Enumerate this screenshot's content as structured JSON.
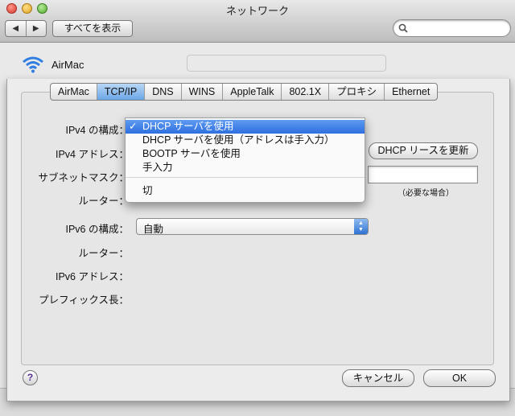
{
  "window": {
    "title": "ネットワーク"
  },
  "toolbar": {
    "back": "◀",
    "forward": "▶",
    "show_all": "すべてを表示",
    "search_placeholder": ""
  },
  "interface": {
    "name": "AirMac"
  },
  "tabs": [
    {
      "label": "AirMac"
    },
    {
      "label": "TCP/IP",
      "selected": true
    },
    {
      "label": "DNS"
    },
    {
      "label": "WINS"
    },
    {
      "label": "AppleTalk"
    },
    {
      "label": "802.1X"
    },
    {
      "label": "プロキシ"
    },
    {
      "label": "Ethernet"
    }
  ],
  "form": {
    "ipv4_config_label": "IPv4 の構成：",
    "ipv4_address_label": "IPv4 アドレス：",
    "subnet_mask_label": "サブネットマスク：",
    "router_label": "ルーター：",
    "ipv6_config_label": "IPv6 の構成：",
    "ipv6_config_value": "自動",
    "ipv6_router_label": "ルーター：",
    "ipv6_address_label": "IPv6 アドレス：",
    "prefix_length_label": "プレフィックス長：",
    "renew_button": "DHCP リースを更新",
    "required_note": "（必要な場合）"
  },
  "ipv4_menu": {
    "checkmark": "✓",
    "items": [
      {
        "label": "DHCP サーバを使用",
        "selected": true
      },
      {
        "label": "DHCP サーバを使用（アドレスは手入力）"
      },
      {
        "label": "BOOTP サーバを使用"
      },
      {
        "label": "手入力"
      },
      {
        "label": "切"
      }
    ]
  },
  "buttons": {
    "help": "?",
    "cancel": "キャンセル",
    "ok": "OK"
  },
  "colors": {
    "accent": "#2d6fe0",
    "tab_selected": "#6aa6e6"
  }
}
